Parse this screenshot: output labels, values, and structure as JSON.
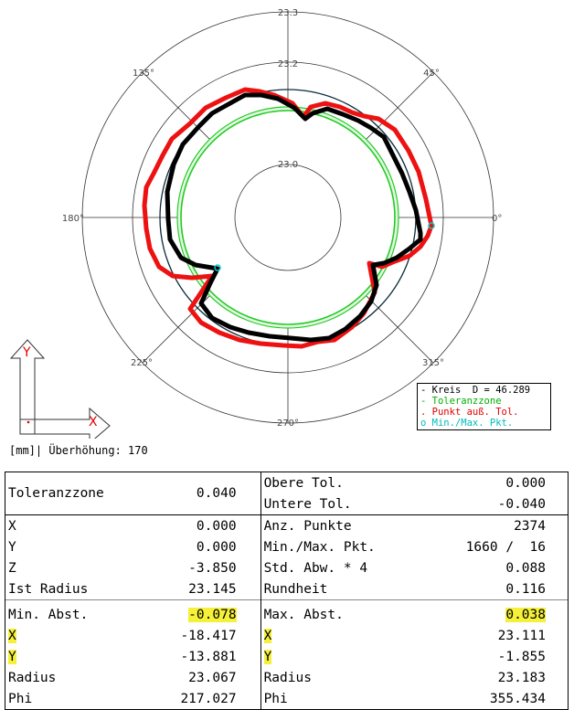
{
  "chart_data": {
    "type": "polar",
    "radial_ticks": [
      "23.3",
      "23.2",
      "23.0"
    ],
    "angle_labels": [
      "0°",
      "45°",
      "135°",
      "180°",
      "225°",
      "270°",
      "315°"
    ],
    "legend": [
      {
        "marker": "-",
        "label": "Kreis  D = 46.289",
        "color": "#000000"
      },
      {
        "marker": "-",
        "label": "Toleranzzone",
        "color": "#00cc00"
      },
      {
        "marker": ".",
        "label": "Punkt auß. Tol.",
        "color": "#ff0000"
      },
      {
        "marker": "o",
        "label": "Min./Max. Pkt.",
        "color": "#00cccc"
      }
    ],
    "colors": {
      "profile_in_tol": "#000000",
      "profile_out_tol": "#ff0000",
      "tolerance_zone": "#00cc00",
      "circle": "#0a2a3a",
      "minmax": "#00cccc"
    },
    "min_point": {
      "x": -18.417,
      "y": -13.881
    },
    "max_point": {
      "x": 23.111,
      "y": -1.855
    }
  },
  "axes_icon": {
    "y": "Y",
    "x": "X"
  },
  "caption": "[mm]| Überhöhung: 170",
  "results": {
    "toleranzzone": {
      "label": "Toleranzzone",
      "value": "0.040"
    },
    "obere_tol": {
      "label": "Obere Tol.",
      "value": "0.000"
    },
    "untere_tol": {
      "label": "Untere Tol.",
      "value": "-0.040"
    },
    "x": {
      "label": "X",
      "value": "0.000"
    },
    "y": {
      "label": "Y",
      "value": "0.000"
    },
    "z": {
      "label": "Z",
      "value": "-3.850"
    },
    "ist_radius": {
      "label": "Ist Radius",
      "value": "23.145"
    },
    "anz_punkte": {
      "label": "Anz. Punkte",
      "value": "2374"
    },
    "minmax_pkt": {
      "label": "Min./Max. Pkt.",
      "value": "1660 /  16"
    },
    "std_abw": {
      "label": "Std. Abw. * 4",
      "value": "0.088"
    },
    "rundheit": {
      "label": "Rundheit",
      "value": "0.116"
    },
    "min_abst": {
      "label": "Min. Abst.",
      "value": "-0.078",
      "x": "-18.417",
      "y": "-13.881",
      "radius_label": "Radius",
      "radius": "23.067",
      "phi_label": "Phi",
      "phi": "217.027",
      "x_label": "X",
      "y_label": "Y"
    },
    "max_abst": {
      "label": "Max. Abst.",
      "value": "0.038",
      "x": "23.111",
      "y": "-1.855",
      "radius_label": "Radius",
      "radius": "23.183",
      "phi_label": "Phi",
      "phi": "355.434",
      "x_label": "X",
      "y_label": "Y"
    }
  }
}
